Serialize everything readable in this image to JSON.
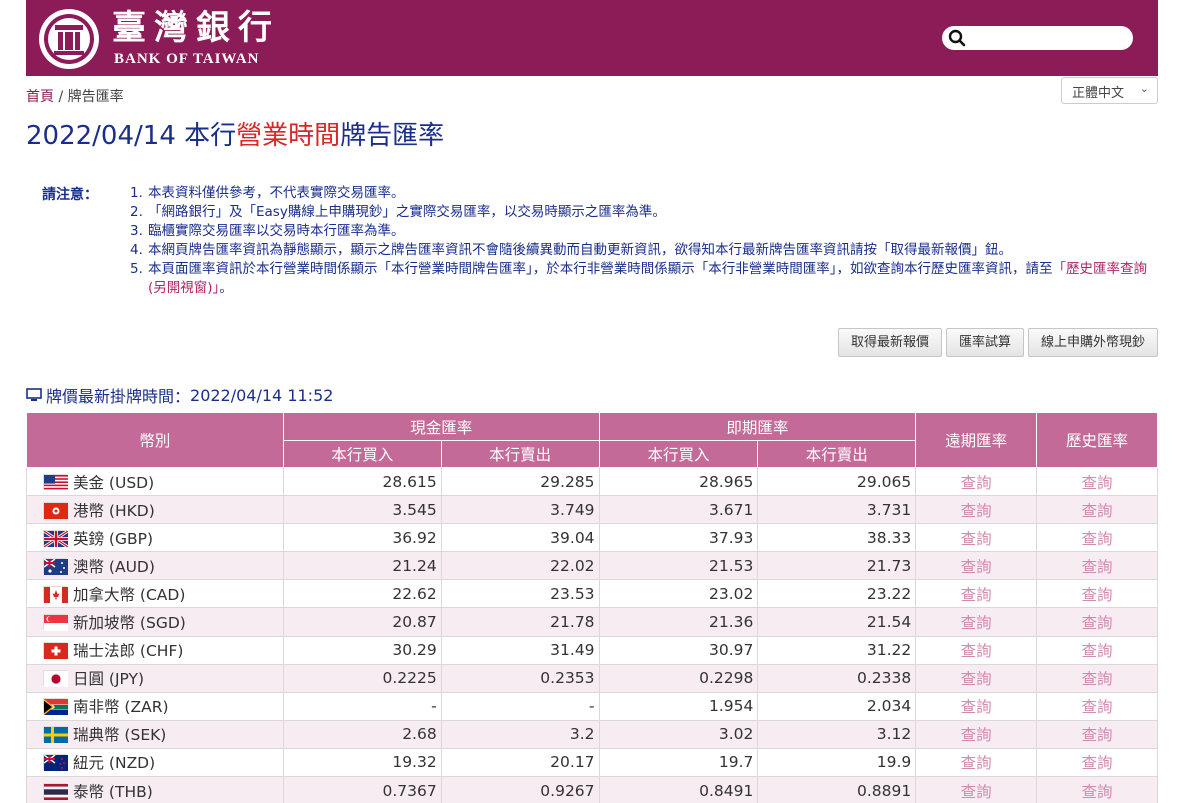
{
  "header": {
    "bank_name_zh": "臺灣銀行",
    "bank_name_en": "BANK OF TAIWAN",
    "search_placeholder": ""
  },
  "breadcrumb": {
    "home": "首頁",
    "sep": " / ",
    "current": "牌告匯率"
  },
  "language": {
    "selected": "正體中文"
  },
  "title": {
    "part1": "2022/04/14 本行",
    "highlight": "營業時間",
    "part2": "牌告匯率"
  },
  "notice": {
    "label": "請注意：",
    "items": [
      {
        "num": "1.",
        "text": "本表資料僅供參考，不代表實際交易匯率。"
      },
      {
        "num": "2.",
        "text": "「網路銀行」及「Easy購線上申購現鈔」之實際交易匯率，以交易時顯示之匯率為準。"
      },
      {
        "num": "3.",
        "text": "臨櫃實際交易匯率以交易時本行匯率為準。"
      },
      {
        "num": "4.",
        "text": "本網頁牌告匯率資訊為靜態顯示，顯示之牌告匯率資訊不會隨後續異動而自動更新資訊，欲得知本行最新牌告匯率資訊請按「取得最新報價」鈕。"
      },
      {
        "num": "5.",
        "text": "本頁面匯率資訊於本行營業時間係顯示「本行營業時間牌告匯率」，於本行非營業時間係顯示「本行非營業時間匯率」，如欲查詢本行歷史匯率資訊，請至",
        "link": "「歷史匯率查詢(另開視窗)」",
        "tail": "。"
      }
    ]
  },
  "buttons": {
    "refresh": "取得最新報價",
    "calculator": "匯率試算",
    "buy_cash": "線上申購外幣現鈔"
  },
  "update_time": {
    "label": "牌價最新掛牌時間：",
    "value": "2022/04/14 11:52"
  },
  "table": {
    "headers": {
      "currency": "幣別",
      "cash": "現金匯率",
      "spot": "即期匯率",
      "forward": "遠期匯率",
      "history": "歷史匯率",
      "buy": "本行買入",
      "sell": "本行賣出"
    },
    "query_label": "查詢",
    "rows": [
      {
        "flag": "us",
        "currency": "美金 (USD)",
        "cash_buy": "28.615",
        "cash_sell": "29.285",
        "spot_buy": "28.965",
        "spot_sell": "29.065"
      },
      {
        "flag": "hk",
        "currency": "港幣 (HKD)",
        "cash_buy": "3.545",
        "cash_sell": "3.749",
        "spot_buy": "3.671",
        "spot_sell": "3.731"
      },
      {
        "flag": "gb",
        "currency": "英鎊 (GBP)",
        "cash_buy": "36.92",
        "cash_sell": "39.04",
        "spot_buy": "37.93",
        "spot_sell": "38.33"
      },
      {
        "flag": "au",
        "currency": "澳幣 (AUD)",
        "cash_buy": "21.24",
        "cash_sell": "22.02",
        "spot_buy": "21.53",
        "spot_sell": "21.73"
      },
      {
        "flag": "ca",
        "currency": "加拿大幣 (CAD)",
        "cash_buy": "22.62",
        "cash_sell": "23.53",
        "spot_buy": "23.02",
        "spot_sell": "23.22"
      },
      {
        "flag": "sg",
        "currency": "新加坡幣 (SGD)",
        "cash_buy": "20.87",
        "cash_sell": "21.78",
        "spot_buy": "21.36",
        "spot_sell": "21.54"
      },
      {
        "flag": "ch",
        "currency": "瑞士法郎 (CHF)",
        "cash_buy": "30.29",
        "cash_sell": "31.49",
        "spot_buy": "30.97",
        "spot_sell": "31.22"
      },
      {
        "flag": "jp",
        "currency": "日圓 (JPY)",
        "cash_buy": "0.2225",
        "cash_sell": "0.2353",
        "spot_buy": "0.2298",
        "spot_sell": "0.2338"
      },
      {
        "flag": "za",
        "currency": "南非幣 (ZAR)",
        "cash_buy": "-",
        "cash_sell": "-",
        "spot_buy": "1.954",
        "spot_sell": "2.034"
      },
      {
        "flag": "se",
        "currency": "瑞典幣 (SEK)",
        "cash_buy": "2.68",
        "cash_sell": "3.2",
        "spot_buy": "3.02",
        "spot_sell": "3.12"
      },
      {
        "flag": "nz",
        "currency": "紐元 (NZD)",
        "cash_buy": "19.32",
        "cash_sell": "20.17",
        "spot_buy": "19.7",
        "spot_sell": "19.9"
      },
      {
        "flag": "th",
        "currency": "泰幣 (THB)",
        "cash_buy": "0.7367",
        "cash_sell": "0.9267",
        "spot_buy": "0.8491",
        "spot_sell": "0.8891"
      }
    ]
  }
}
